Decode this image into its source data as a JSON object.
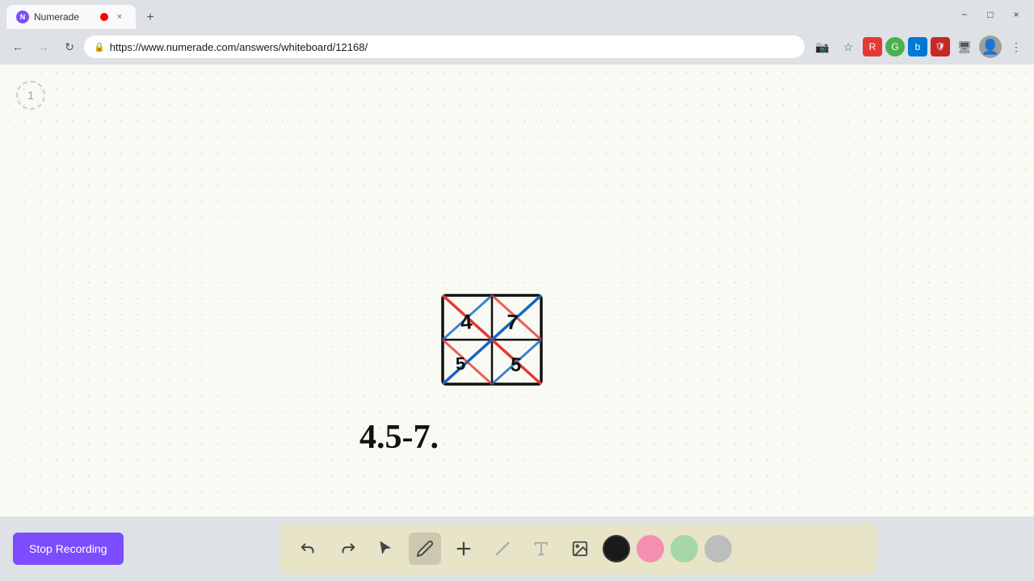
{
  "browser": {
    "title": "Numerade",
    "url": "https://www.numerade.com/answers/whiteboard/12168/",
    "favicon_text": "N"
  },
  "tabs": [
    {
      "label": "Numerade",
      "recording": true,
      "active": true
    }
  ],
  "nav": {
    "back_disabled": false,
    "forward_disabled": true
  },
  "toolbar": {
    "address": "https://www.numerade.com/answers/whiteboard/12168/"
  },
  "page": {
    "number": "1"
  },
  "tools": {
    "undo_label": "↩",
    "redo_label": "↪",
    "select_label": "▲",
    "pen_label": "✏",
    "add_label": "+",
    "eraser_label": "/",
    "text_label": "A",
    "image_label": "🖼"
  },
  "colors": {
    "black": "#1a1a1a",
    "pink": "#f48fb1",
    "green": "#a5d6a7",
    "gray": "#bdbdbd"
  },
  "bottom_bar": {
    "stop_recording_label": "Stop Recording"
  },
  "window_controls": {
    "minimize": "−",
    "maximize": "□",
    "close": "×"
  }
}
